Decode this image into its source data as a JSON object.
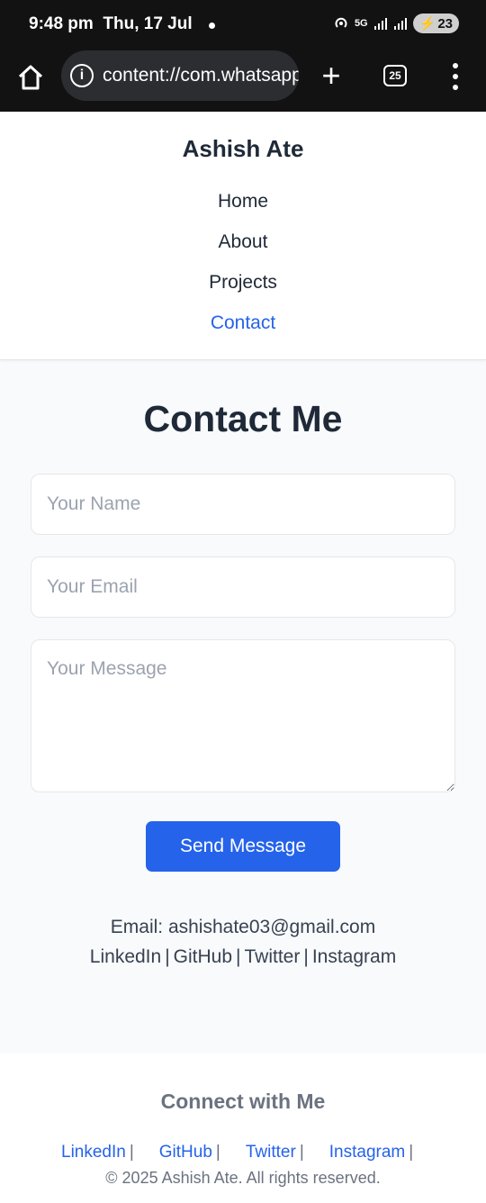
{
  "status_bar": {
    "time": "9:48 pm",
    "date": "Thu, 17 Jul",
    "network": "5G",
    "battery": "23"
  },
  "browser": {
    "url": "content://com.whatsapp",
    "tab_count": "25"
  },
  "header": {
    "site_title": "Ashish Ate",
    "nav": [
      "Home",
      "About",
      "Projects",
      "Contact"
    ],
    "active_nav": "Contact"
  },
  "contact": {
    "heading": "Contact Me",
    "name_placeholder": "Your Name",
    "email_placeholder": "Your Email",
    "message_placeholder": "Your Message",
    "send_label": "Send Message",
    "email_line": "Email: ashishate03@gmail.com",
    "social": [
      "LinkedIn",
      "GitHub",
      "Twitter",
      "Instagram"
    ],
    "separator": "|"
  },
  "footer": {
    "title": "Connect with Me",
    "links": [
      "LinkedIn",
      "GitHub",
      "Twitter",
      "Instagram"
    ],
    "separator": "|",
    "copyright": "© 2025 Ashish Ate. All rights reserved."
  },
  "colors": {
    "accent": "#2563eb",
    "page_bg": "#f8fafc",
    "text": "#1f2937"
  }
}
